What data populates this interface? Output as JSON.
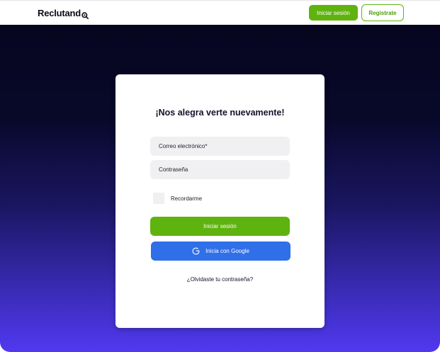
{
  "header": {
    "logo_text": "Reclutand",
    "login_label": "Iniciar sesión",
    "register_label": "Registrate"
  },
  "login_card": {
    "title": "¡Nos alegra verte nuevamente!",
    "email_placeholder": "Correo electrónico*",
    "password_placeholder": "Contraseña",
    "remember_label": "Recordarme",
    "remember_checked": false,
    "submit_label": "Iniciar sesión",
    "google_label": "Inicia con Google",
    "forgot_label": "¿Olvidaste tu contraseña?"
  },
  "colors": {
    "brand_green": "#5fb30e",
    "google_blue": "#2f6fe8",
    "hero_top": "#060620",
    "hero_bottom": "#5238f0"
  },
  "icons": {
    "logo_mark": "magnifier-icon",
    "google": "google-g-icon"
  }
}
